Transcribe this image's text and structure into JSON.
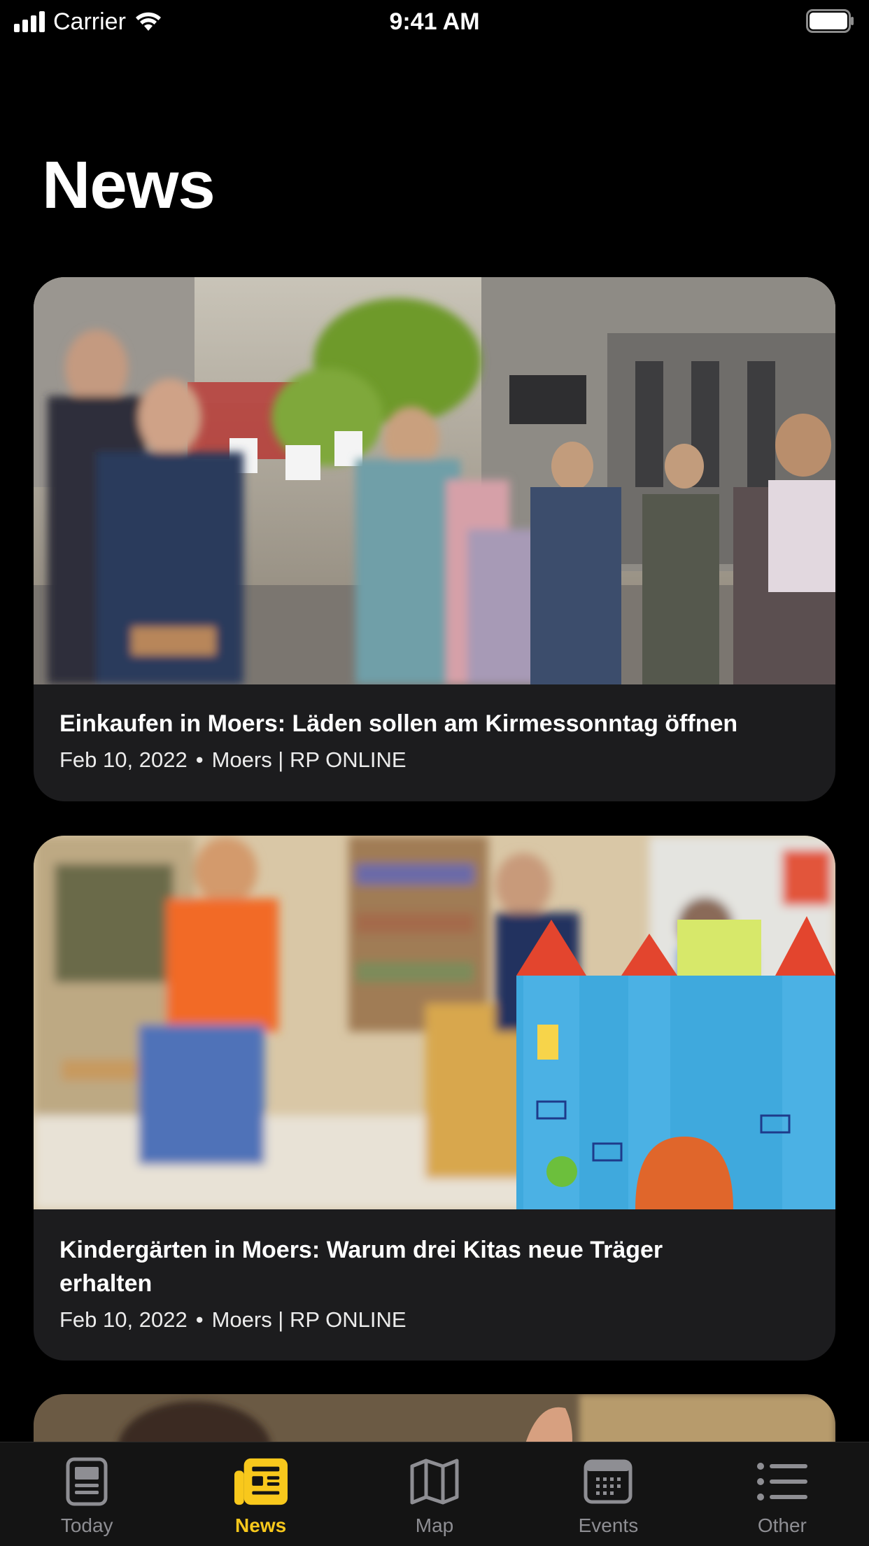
{
  "status_bar": {
    "carrier": "Carrier",
    "time": "9:41 AM"
  },
  "header": {
    "title": "News"
  },
  "articles": [
    {
      "title": "Einkaufen in Moers: Läden sollen am Kirmessonntag öffnen",
      "date": "Feb 10, 2022",
      "separator": "•",
      "source": "Moers | RP ONLINE"
    },
    {
      "title": "Kindergärten in Moers: Warum drei Kitas neue Träger erhalten",
      "date": "Feb 10, 2022",
      "separator": "•",
      "source": "Moers | RP ONLINE"
    }
  ],
  "tab_bar": {
    "items": [
      {
        "label": "Today",
        "icon": "today-icon",
        "active": false
      },
      {
        "label": "News",
        "icon": "news-icon",
        "active": true
      },
      {
        "label": "Map",
        "icon": "map-icon",
        "active": false
      },
      {
        "label": "Events",
        "icon": "calendar-icon",
        "active": false
      },
      {
        "label": "Other",
        "icon": "list-icon",
        "active": false
      }
    ]
  },
  "colors": {
    "background": "#000000",
    "card": "#1c1c1e",
    "accent": "#f8c81c",
    "inactive": "#8e8e93"
  }
}
